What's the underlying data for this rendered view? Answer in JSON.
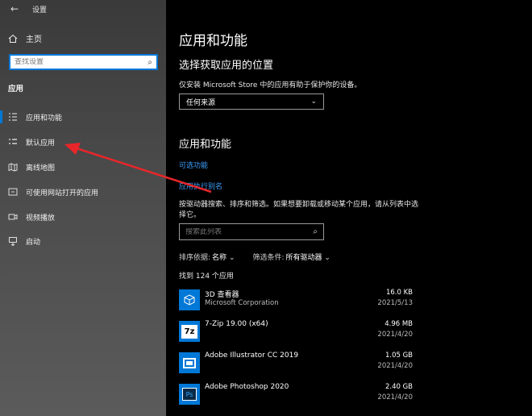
{
  "window": {
    "title": "设置"
  },
  "sidebar": {
    "home_label": "主页",
    "search_placeholder": "查找设置",
    "section_title": "应用",
    "items": [
      {
        "label": "应用和功能",
        "icon": "list-icon",
        "active": true
      },
      {
        "label": "默认应用",
        "icon": "default-apps-icon",
        "active": false
      },
      {
        "label": "离线地图",
        "icon": "map-icon",
        "active": false
      },
      {
        "label": "可使用网站打开的应用",
        "icon": "website-apps-icon",
        "active": false
      },
      {
        "label": "视频播放",
        "icon": "video-icon",
        "active": false
      },
      {
        "label": "启动",
        "icon": "startup-icon",
        "active": false
      }
    ]
  },
  "main": {
    "title": "应用和功能",
    "choose_location": {
      "heading": "选择获取应用的位置",
      "description": "仅安装 Microsoft Store 中的应用有助于保护你的设备。",
      "dropdown_value": "任何来源"
    },
    "apps_section": {
      "heading": "应用和功能",
      "link_optional": "可选功能",
      "link_alias": "应用执行别名",
      "instruction": "按驱动器搜索、排序和筛选。如果想要卸载或移动某个应用，请从列表中选择它。",
      "search_placeholder": "搜索此列表",
      "sort_label": "排序依据:",
      "sort_value": "名称",
      "filter_label": "筛选条件:",
      "filter_value": "所有驱动器",
      "found_text": "找到 124 个应用"
    },
    "apps": [
      {
        "name": "3D 查看器",
        "publisher": "Microsoft Corporation",
        "size": "16.0 KB",
        "date": "2021/5/13",
        "icon": "3d-viewer-icon"
      },
      {
        "name": "7-Zip 19.00 (x64)",
        "publisher": "",
        "size": "4.96 MB",
        "date": "2021/4/20",
        "icon": "7zip-icon"
      },
      {
        "name": "Adobe Illustrator CC 2019",
        "publisher": "",
        "size": "1.05 GB",
        "date": "2021/4/20",
        "icon": "illustrator-icon"
      },
      {
        "name": "Adobe Photoshop 2020",
        "publisher": "",
        "size": "2.40 GB",
        "date": "2021/4/20",
        "icon": "photoshop-icon"
      }
    ]
  },
  "colors": {
    "accent": "#0078d7",
    "link": "#3ca1ff",
    "arrow": "#e8262a"
  }
}
